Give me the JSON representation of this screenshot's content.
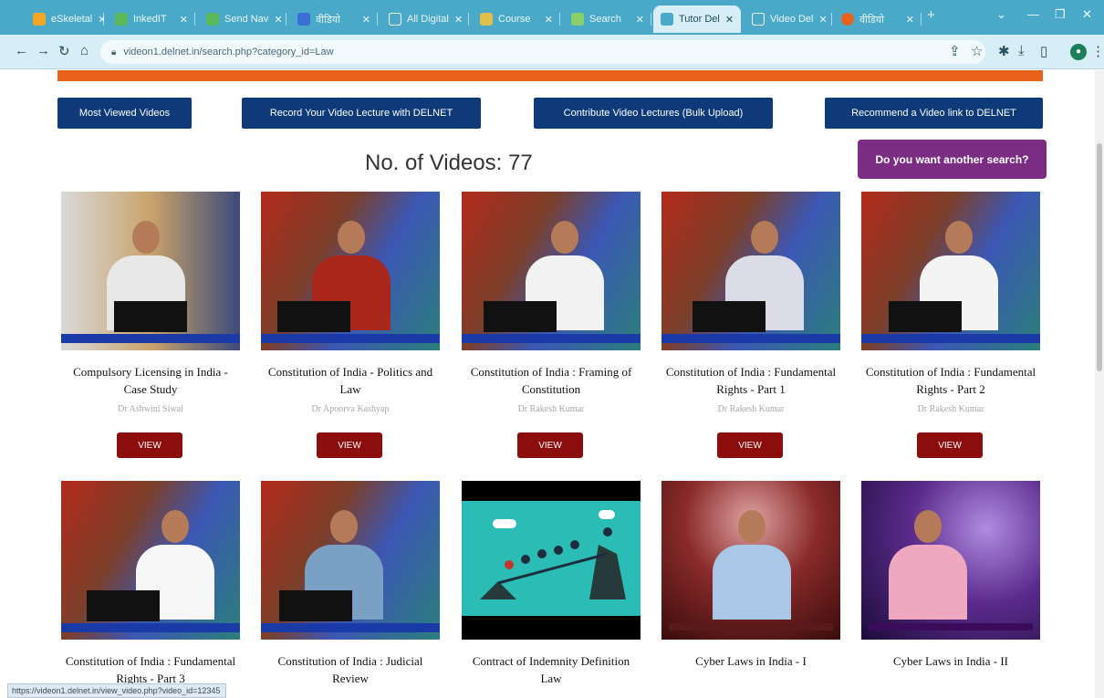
{
  "browser": {
    "tabs": [
      {
        "label": "eSkeletal",
        "color": "#f5a623"
      },
      {
        "label": "InkedIT",
        "color": "#5bb85b"
      },
      {
        "label": "Send Nav",
        "color": "#5bb85b"
      },
      {
        "label": "वीडियो",
        "color": "#3a6fd8"
      },
      {
        "label": "All Digital",
        "color": "#4aa9c9"
      },
      {
        "label": "Course",
        "color": "#e0c04a"
      },
      {
        "label": "Search",
        "color": "#8ad06a"
      },
      {
        "label": "Tutor Del",
        "color": "#4aa9c9"
      },
      {
        "label": "Video Del",
        "color": "#4aa9c9"
      },
      {
        "label": "वीडियो",
        "color": "#e8621c"
      }
    ],
    "new_tab": "+",
    "url": "videon1.delnet.in/search.php?category_id=Law"
  },
  "top_buttons": {
    "most_viewed": "Most Viewed Videos",
    "record": "Record Your Video Lecture with DELNET",
    "contribute": "Contribute Video Lectures (Bulk Upload)",
    "recommend": "Recommend a Video link to DELNET"
  },
  "video_count": "No. of Videos: 77",
  "another_search": "Do you want another search?",
  "view_label": "VIEW",
  "videos": [
    {
      "title": "Compulsory Licensing in India - Case Study",
      "author": "Dr Ashwini Siwal"
    },
    {
      "title": "Constitution of India - Politics and Law",
      "author": "Dr Apoorva Kashyap"
    },
    {
      "title": "Constitution of India : Framing of Constitution",
      "author": "Dr Rakesh Kumar"
    },
    {
      "title": "Constitution of India : Fundamental Rights - Part 1",
      "author": "Dr Rakesh Kumar"
    },
    {
      "title": "Constitution of India : Fundamental Rights - Part 2",
      "author": "Dr Rakesh Kumar"
    },
    {
      "title": "Constitution of India : Fundamental Rights - Part 3",
      "author": ""
    },
    {
      "title": "Constitution of India : Judicial Review",
      "author": ""
    },
    {
      "title": "Contract of Indemnity Definition Law",
      "author": ""
    },
    {
      "title": "Cyber Laws in India - I",
      "author": ""
    },
    {
      "title": "Cyber Laws in India - II",
      "author": ""
    }
  ],
  "status_url": "https://videon1.delnet.in/view_video.php?video_id=12345"
}
